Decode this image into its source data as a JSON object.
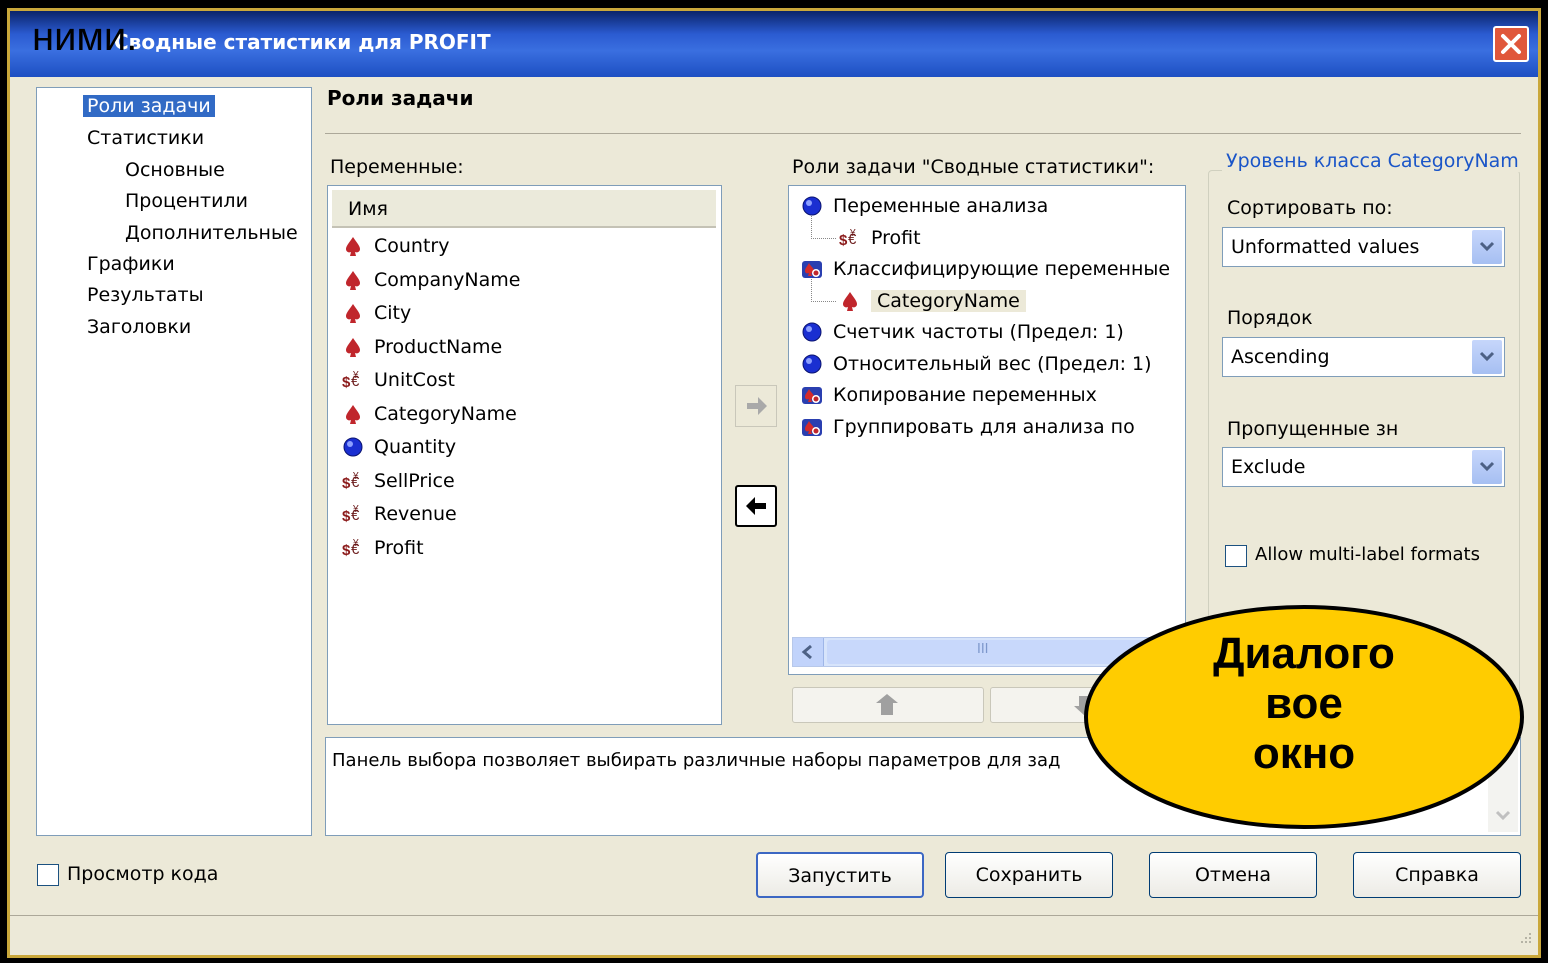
{
  "window": {
    "title": "Сводные статистики для PROFIT",
    "overlay_caption": "ними."
  },
  "nav": {
    "items": [
      {
        "label": "Роли задачи",
        "selected": true
      },
      {
        "label": "Статистики"
      },
      {
        "label": "Основные"
      },
      {
        "label": "Процентили"
      },
      {
        "label": "Дополнительные"
      },
      {
        "label": "Графики"
      },
      {
        "label": "Результаты"
      },
      {
        "label": "Заголовки"
      }
    ]
  },
  "section": {
    "title": "Роли задачи"
  },
  "variables": {
    "label": "Переменные:",
    "column_header": "Имя",
    "items": [
      {
        "name": "Country",
        "type": "character"
      },
      {
        "name": "CompanyName",
        "type": "character"
      },
      {
        "name": "City",
        "type": "character"
      },
      {
        "name": "ProductName",
        "type": "character"
      },
      {
        "name": "UnitCost",
        "type": "currency"
      },
      {
        "name": "CategoryName",
        "type": "character"
      },
      {
        "name": "Quantity",
        "type": "numeric"
      },
      {
        "name": "SellPrice",
        "type": "currency"
      },
      {
        "name": "Revenue",
        "type": "currency"
      },
      {
        "name": "Profit",
        "type": "currency"
      }
    ]
  },
  "roles": {
    "label": "Роли задачи \"Сводные статистики\":",
    "items": [
      {
        "label": "Переменные анализа",
        "icon": "numeric-role-icon"
      },
      {
        "label": "Profit",
        "icon": "currency-icon",
        "child": true
      },
      {
        "label": "Классифицирующие переменные",
        "icon": "mixed-role-icon"
      },
      {
        "label": "CategoryName",
        "icon": "character-icon",
        "child": true,
        "selected": true
      },
      {
        "label": "Счетчик частоты  (Предел: 1)",
        "icon": "numeric-role-icon"
      },
      {
        "label": "Относительный вес  (Предел: 1)",
        "icon": "numeric-role-icon"
      },
      {
        "label": "Копирование переменных",
        "icon": "mixed-role-icon"
      },
      {
        "label": "Группировать для анализа по",
        "icon": "mixed-role-icon"
      }
    ],
    "scrollbar_grip": "III"
  },
  "class_level": {
    "legend": "Уровень класса CategoryNam",
    "sort_label": "Сортировать по:",
    "sort_value": "Unformatted values",
    "order_label": "Порядок",
    "order_value": "Ascending",
    "missing_label": "Пропущенные зн",
    "missing_value": "Exclude",
    "multilabel_label": "Allow multi-label formats",
    "multilabel_checked": false
  },
  "description": {
    "text": "Панель выбора позволяет выбирать различные наборы параметров для зад"
  },
  "footer": {
    "preview_code_label": "Просмотр кода",
    "preview_code_checked": false,
    "buttons": {
      "run": "Запустить",
      "save": "Сохранить",
      "cancel": "Отмена",
      "help": "Справка"
    }
  },
  "callout": {
    "line1": "Диалого",
    "line2": "вое",
    "line3": "окно",
    "fill": "#ffcc00"
  },
  "colors": {
    "selection": "#316ac5",
    "titlebar": "#2b5bd1",
    "legend_text": "#1a55c8"
  }
}
